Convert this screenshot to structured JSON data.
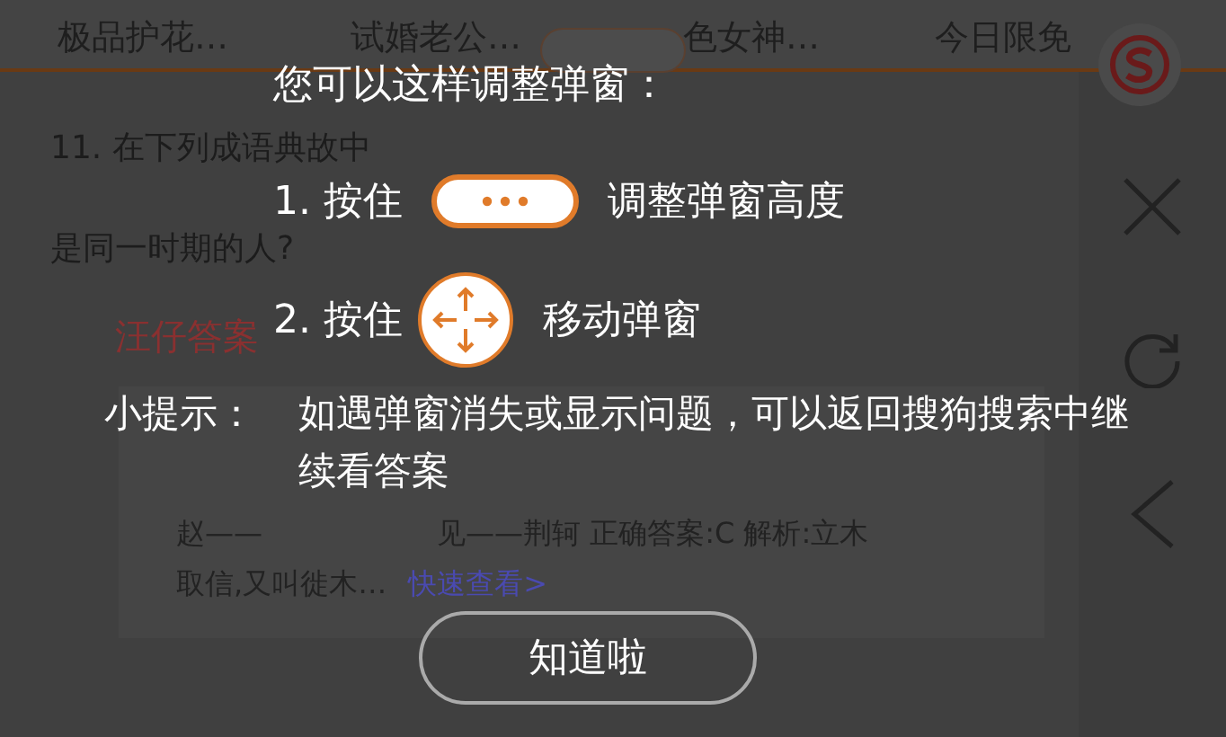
{
  "tabs": [
    {
      "label": "极品护花…"
    },
    {
      "label": "试婚老公…"
    },
    {
      "label": "色女神…"
    },
    {
      "label": "今日限免"
    }
  ],
  "question": [
    "11. 在下列成语典故中",
    "是同一时期的人?"
  ],
  "answer_heading": "汪仔答案",
  "card": {
    "line_1": [
      "赵——",
      "见——荆轲 正确答案:C 解析:立木"
    ],
    "line_2": "取信,又叫徙木…",
    "link": "快速查看>"
  },
  "guide": {
    "title": "您可以这样调整弹窗：",
    "steps": [
      {
        "kind": "height",
        "prefix": "1. 按住",
        "text": "调整弹窗高度"
      },
      {
        "kind": "move",
        "prefix": "2. 按住",
        "text": "移动弹窗"
      }
    ],
    "tip_label": "小提示：",
    "tip": "如遇弹窗消失或显示问题，可以返回搜狗搜索中继续看答案",
    "button": "知道啦"
  }
}
